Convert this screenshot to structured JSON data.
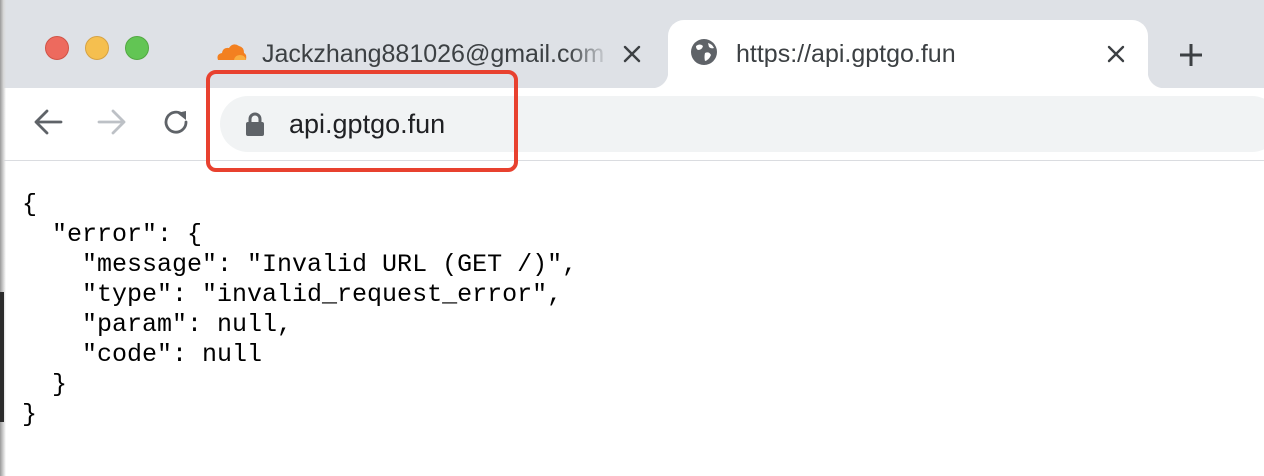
{
  "window": {
    "traffic_lights": {
      "close_color": "#ed6a5e",
      "minimize_color": "#f5bf4f",
      "maximize_color": "#62c554"
    }
  },
  "tabs": [
    {
      "title": "Jackzhang881026@gmail.com",
      "icon": "cloudflare-icon",
      "active": false
    },
    {
      "title": "https://api.gptgo.fun",
      "icon": "globe-icon",
      "active": true
    }
  ],
  "toolbar": {
    "back_icon": "back-arrow-icon",
    "forward_icon": "forward-arrow-icon",
    "reload_icon": "reload-icon",
    "address": "api.gptgo.fun",
    "security_icon": "lock-icon"
  },
  "annotation": {
    "color": "#e8412f"
  },
  "page": {
    "json_lines": [
      "{",
      "  \"error\": {",
      "    \"message\": \"Invalid URL (GET /)\",",
      "    \"type\": \"invalid_request_error\",",
      "    \"param\": null,",
      "    \"code\": null",
      "  }",
      "}"
    ]
  }
}
